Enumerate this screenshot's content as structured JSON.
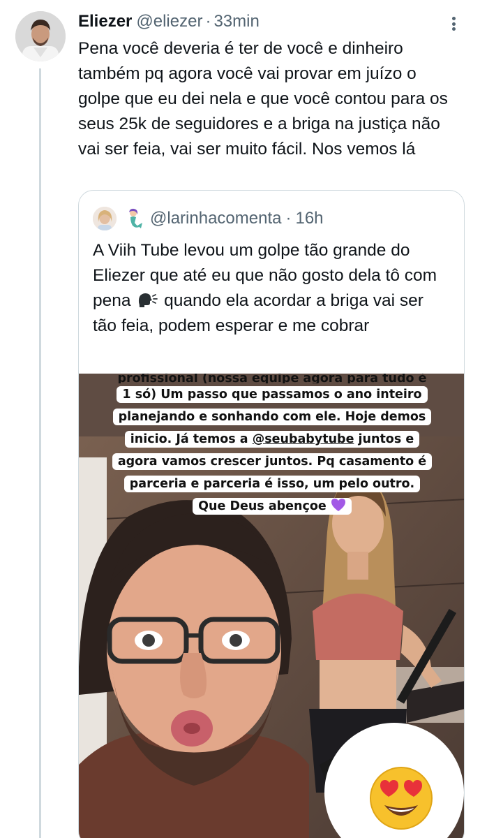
{
  "tweet": {
    "author_name": "Eliezer",
    "handle": "@eliezer",
    "separator": "·",
    "time": "33min",
    "text": "Pena você deveria é ter de você e dinheiro também pq agora você vai provar em juízo o golpe que eu dei nela e que você contou para os seus 25k de seguidores e a briga na justiça não vai ser feia, vai ser muito fácil. Nos vemos lá"
  },
  "quote": {
    "handle": "@larinhacomenta",
    "separator": "·",
    "time": "16h",
    "text_before_icon": "A Viih Tube levou um golpe tão grande do Eliezer que até eu que não gosto dela tô com pena",
    "text_after_icon": "quando ela acordar a briga vai ser tão feia, podem esperar e me cobrar",
    "media": {
      "caption_cut_line": "profissional (nossa equipe agora para tudo é",
      "caption_lines": [
        "1 só) Um passo que passamos o ano inteiro",
        "planejando e sonhando com ele. Hoje demos",
        "inicio. Já temos a",
        "juntos e",
        "agora vamos crescer juntos. Pq casamento é",
        "parceria e parceria é isso, um pelo outro.",
        "Que Deus abençoe"
      ],
      "caption_mention": "@seubabytube",
      "sticker_icon": "heart-eyes-emoji"
    }
  },
  "colors": {
    "text": "#0f1419",
    "secondary": "#536471",
    "border": "#cfd9de",
    "heart": "#a259e6"
  }
}
